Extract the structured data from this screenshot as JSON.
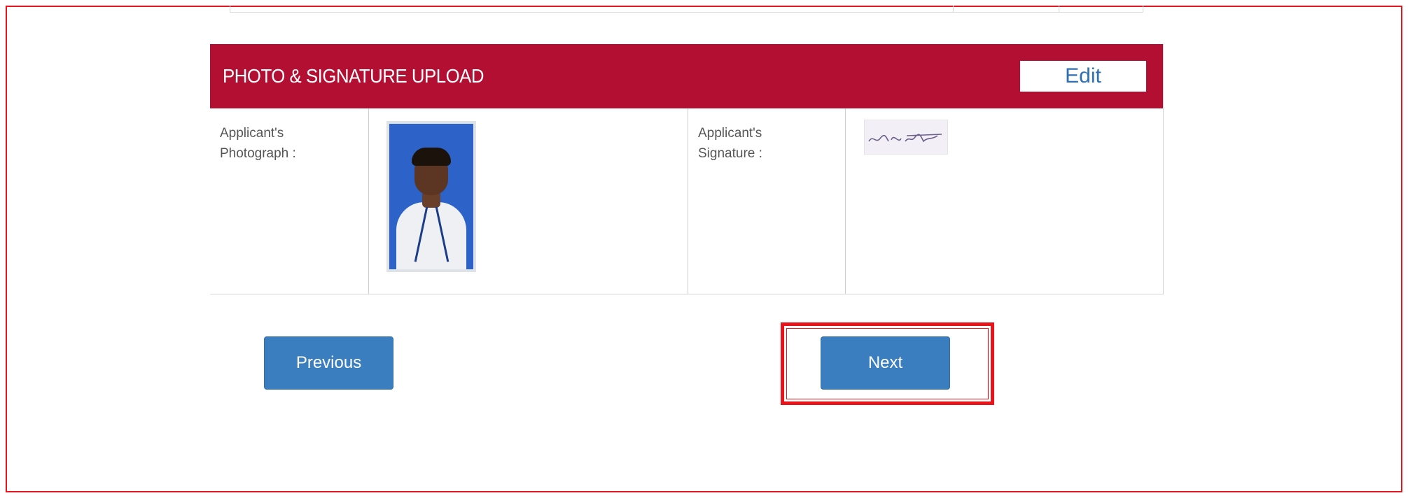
{
  "section": {
    "title": "PHOTO & SIGNATURE UPLOAD",
    "edit_label": "Edit",
    "header_color": "#b30f33"
  },
  "photo_row": {
    "photo_label": "Applicant's\nPhotograph :",
    "signature_label": "Applicant's\nSignature :"
  },
  "navigation": {
    "previous_label": "Previous",
    "next_label": "Next",
    "button_color": "#3a7ebf"
  },
  "annotation": {
    "highlight_color": "#e8141c"
  }
}
